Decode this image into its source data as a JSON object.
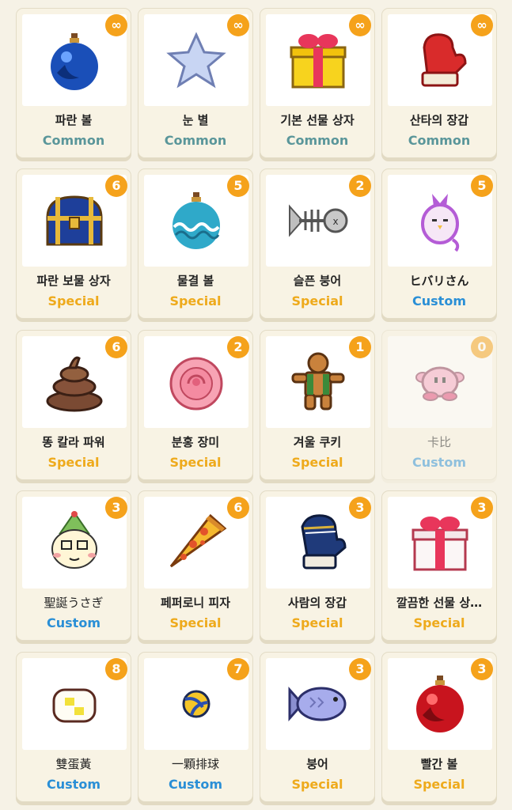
{
  "colors": {
    "common": "#5a969a",
    "special": "#eeaa1c",
    "custom": "#2a8fd6",
    "badge": "#f5a21b"
  },
  "items": [
    {
      "name": "파란 볼",
      "rarity": "Common",
      "count": "∞",
      "icon": "blue-ornament-icon"
    },
    {
      "name": "눈 별",
      "rarity": "Common",
      "count": "∞",
      "icon": "snow-star-icon"
    },
    {
      "name": "기본 선물 상자",
      "rarity": "Common",
      "count": "∞",
      "icon": "yellow-gift-box-icon"
    },
    {
      "name": "산타의 장갑",
      "rarity": "Common",
      "count": "∞",
      "icon": "santa-mitten-icon"
    },
    {
      "name": "파란 보물 상자",
      "rarity": "Special",
      "count": "6",
      "icon": "blue-treasure-chest-icon"
    },
    {
      "name": "물결 볼",
      "rarity": "Special",
      "count": "5",
      "icon": "wave-ornament-icon"
    },
    {
      "name": "슬픈 붕어",
      "rarity": "Special",
      "count": "2",
      "icon": "fish-bone-icon"
    },
    {
      "name": "ヒバリさん",
      "rarity": "Custom",
      "count": "5",
      "icon": "purple-bird-icon"
    },
    {
      "name": "똥 칼라 파워",
      "rarity": "Special",
      "count": "6",
      "icon": "poop-icon"
    },
    {
      "name": "분홍 장미",
      "rarity": "Special",
      "count": "2",
      "icon": "pink-rose-icon"
    },
    {
      "name": "겨울 쿠키",
      "rarity": "Special",
      "count": "1",
      "icon": "gingerbread-cookie-icon"
    },
    {
      "name": "卡比",
      "rarity": "Custom",
      "count": "0",
      "icon": "kirby-icon"
    },
    {
      "name": "聖誕うさぎ",
      "rarity": "Custom",
      "count": "3",
      "icon": "christmas-rabbit-icon"
    },
    {
      "name": "페퍼로니 피자",
      "rarity": "Special",
      "count": "6",
      "icon": "pizza-slice-icon"
    },
    {
      "name": "사람의 장갑",
      "rarity": "Special",
      "count": "3",
      "icon": "blue-mitten-icon"
    },
    {
      "name": "깔끔한 선물 상…",
      "rarity": "Special",
      "count": "3",
      "icon": "white-gift-box-icon"
    },
    {
      "name": "雙蛋黃",
      "rarity": "Custom",
      "count": "8",
      "icon": "double-yolk-egg-icon"
    },
    {
      "name": "一顆排球",
      "rarity": "Custom",
      "count": "7",
      "icon": "volleyball-icon"
    },
    {
      "name": "붕어",
      "rarity": "Special",
      "count": "3",
      "icon": "taiyaki-fish-icon"
    },
    {
      "name": "빨간 볼",
      "rarity": "Special",
      "count": "3",
      "icon": "red-ornament-icon"
    }
  ]
}
